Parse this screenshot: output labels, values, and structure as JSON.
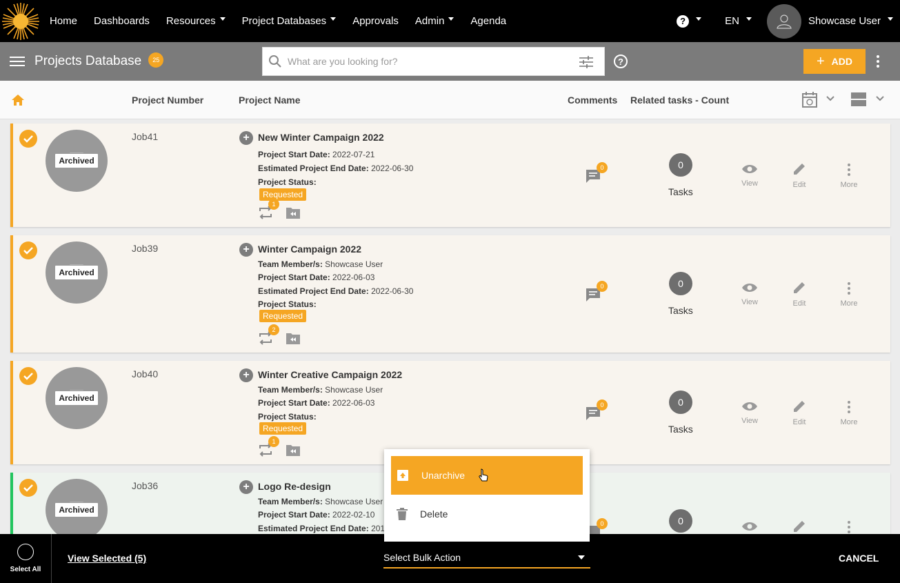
{
  "nav": {
    "items": [
      {
        "label": "Home",
        "dropdown": false
      },
      {
        "label": "Dashboards",
        "dropdown": false
      },
      {
        "label": "Resources",
        "dropdown": true
      },
      {
        "label": "Project Databases",
        "dropdown": true
      },
      {
        "label": "Approvals",
        "dropdown": false
      },
      {
        "label": "Admin",
        "dropdown": true
      },
      {
        "label": "Agenda",
        "dropdown": false
      }
    ],
    "help_label": "?",
    "language": "EN",
    "user_name": "Showcase User"
  },
  "toolbar": {
    "title": "Projects Database",
    "count": "25",
    "search_placeholder": "What are you looking for?",
    "help_label": "?",
    "add_label": "ADD"
  },
  "columns": {
    "project_number": "Project Number",
    "project_name": "Project Name",
    "comments": "Comments",
    "related_tasks": "Related tasks - Count"
  },
  "labels": {
    "team": "Team Member/s:",
    "start": "Project Start Date:",
    "end": "Estimated Project End Date:",
    "status": "Project Status:",
    "tasks": "Tasks",
    "view": "View",
    "edit": "Edit",
    "more": "More",
    "archived": "Archived"
  },
  "projects": [
    {
      "job": "Job41",
      "name": "New Winter Campaign 2022",
      "team": "",
      "start": "2022-07-21",
      "end": "2022-06-30",
      "status": "Requested",
      "workflow_count": "1",
      "comments": "0",
      "tasks": "0"
    },
    {
      "job": "Job39",
      "name": "Winter Campaign 2022",
      "team": "Showcase User",
      "start": "2022-06-03",
      "end": "2022-06-30",
      "status": "Requested",
      "workflow_count": "2",
      "comments": "0",
      "tasks": "0"
    },
    {
      "job": "Job40",
      "name": "Winter Creative Campaign 2022",
      "team": "Showcase User",
      "start": "2022-06-03",
      "end": "",
      "status": "Requested",
      "workflow_count": "1",
      "comments": "0",
      "tasks": "0"
    },
    {
      "job": "Job36",
      "name": "Logo Re-design",
      "team": "Showcase User",
      "start": "2022-02-10",
      "end": "201",
      "status": "",
      "workflow_count": "",
      "comments": "0",
      "tasks": "0"
    }
  ],
  "bulk_menu": {
    "options": [
      "Unarchive",
      "Delete"
    ]
  },
  "bottom": {
    "select_all": "Select All",
    "view_selected": "View Selected (5)",
    "bulk_action": "Select Bulk Action",
    "cancel": "CANCEL"
  },
  "colors": {
    "accent": "#f5a623",
    "toolbar": "#7b7b7b",
    "nav": "#000000",
    "row_green_border": "#22c55e"
  }
}
